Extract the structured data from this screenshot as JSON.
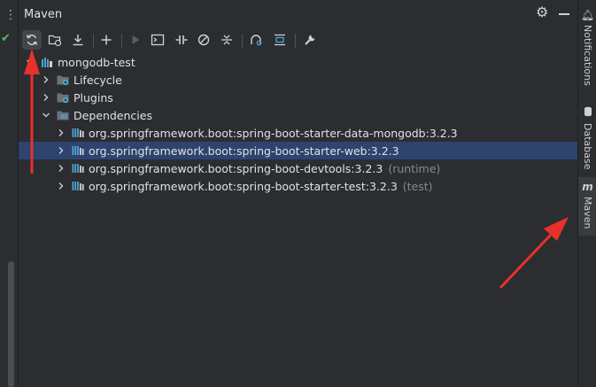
{
  "panel": {
    "title": "Maven"
  },
  "toolbar": {
    "buttons": [
      {
        "name": "reload-all-maven-projects",
        "icon": "refresh-icon"
      },
      {
        "name": "generate-sources",
        "icon": "folder-refresh-icon"
      },
      {
        "name": "download-sources",
        "icon": "download-icon"
      },
      {
        "name": "add-maven-project",
        "icon": "plus-icon"
      },
      {
        "name": "run-maven-build",
        "icon": "play-icon"
      },
      {
        "name": "execute-maven-goal",
        "icon": "terminal-icon"
      },
      {
        "name": "toggle-offline-mode",
        "icon": "offline-icon"
      },
      {
        "name": "skip-tests",
        "icon": "skip-tests-icon"
      },
      {
        "name": "collapse-all",
        "icon": "collapse-all-icon"
      },
      {
        "name": "analyze-dependencies",
        "icon": "analyze-icon"
      },
      {
        "name": "show-dependencies",
        "icon": "diagram-icon"
      },
      {
        "name": "maven-settings",
        "icon": "wrench-icon"
      }
    ]
  },
  "tree": {
    "project": "mongodb-test",
    "lifecycle": "Lifecycle",
    "plugins": "Plugins",
    "dependencies": "Dependencies",
    "deps": [
      {
        "label": "org.springframework.boot:spring-boot-starter-data-mongodb:3.2.3",
        "scope": ""
      },
      {
        "label": "org.springframework.boot:spring-boot-starter-web:3.2.3",
        "scope": ""
      },
      {
        "label": "org.springframework.boot:spring-boot-devtools:3.2.3",
        "scope": "(runtime)"
      },
      {
        "label": "org.springframework.boot:spring-boot-starter-test:3.2.3",
        "scope": "(test)"
      }
    ],
    "selected_index": 1
  },
  "sidebar": {
    "tabs": [
      {
        "label": "Notifications",
        "icon": "bell-icon"
      },
      {
        "label": "Database",
        "icon": "database-icon"
      },
      {
        "label": "Maven",
        "icon": "maven-icon",
        "glyph": "m"
      }
    ]
  },
  "colors": {
    "background": "#2b2d30",
    "selection": "#2e436e",
    "annotation_arrow": "#e8312b",
    "check": "#5fb865",
    "bars": "#4fa3d1"
  }
}
